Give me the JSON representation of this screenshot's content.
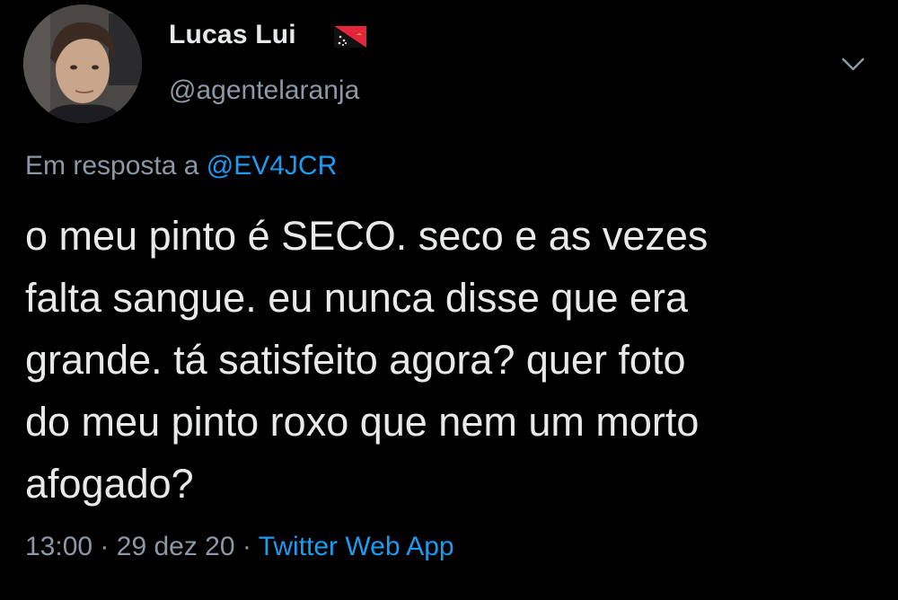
{
  "user": {
    "display_name": "Lucas Lui",
    "handle": "@agentelaranja",
    "flag_icon": "papua-new-guinea-flag-icon",
    "avatar_icon": "profile-photo"
  },
  "reply": {
    "prefix": "Em resposta a",
    "mention": "@EV4JCR"
  },
  "tweet": {
    "lines": [
      "o meu pinto é SECO. seco e as vezes",
      "falta sangue. eu nunca disse que era",
      "grande. tá satisfeito agora? quer foto",
      "do meu pinto roxo que nem um morto",
      "afogado?"
    ]
  },
  "meta": {
    "time": "13:00",
    "separator": "·",
    "date": "29 dez 20",
    "source": "Twitter Web App"
  },
  "colors": {
    "background": "#000000",
    "text": "#e7e9ea",
    "muted": "#8b98a5",
    "accent": "#1d9bf0"
  }
}
